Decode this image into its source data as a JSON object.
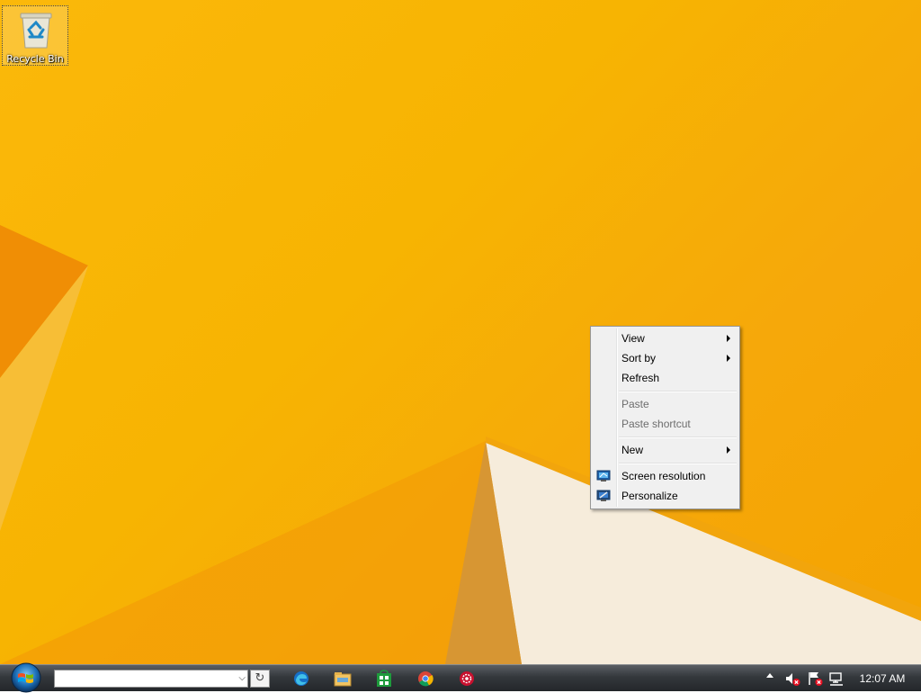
{
  "desktop": {
    "icons": [
      {
        "label": "Recycle Bin",
        "icon": "recycle-bin-icon"
      }
    ]
  },
  "context_menu": {
    "items": [
      {
        "label": "View",
        "has_submenu": true,
        "enabled": true
      },
      {
        "label": "Sort by",
        "has_submenu": true,
        "enabled": true
      },
      {
        "label": "Refresh",
        "has_submenu": false,
        "enabled": true
      },
      {
        "label": "Paste",
        "has_submenu": false,
        "enabled": false
      },
      {
        "label": "Paste shortcut",
        "has_submenu": false,
        "enabled": false
      },
      {
        "label": "New",
        "has_submenu": true,
        "enabled": true
      },
      {
        "label": "Screen resolution",
        "icon": "monitor-icon",
        "enabled": true
      },
      {
        "label": "Personalize",
        "icon": "personalize-icon",
        "enabled": true
      }
    ]
  },
  "taskbar": {
    "start_icon": "windows-orb-icon",
    "address_bar": {
      "value": ""
    },
    "pinned_apps": [
      {
        "icon": "edge-icon"
      },
      {
        "icon": "file-explorer-icon"
      },
      {
        "icon": "store-icon"
      },
      {
        "icon": "chrome-icon"
      },
      {
        "icon": "red-gear-app-icon"
      }
    ],
    "tray_icons": [
      "volume-muted-icon",
      "action-center-flag-icon",
      "network-icon"
    ],
    "clock": "12:07 AM"
  }
}
